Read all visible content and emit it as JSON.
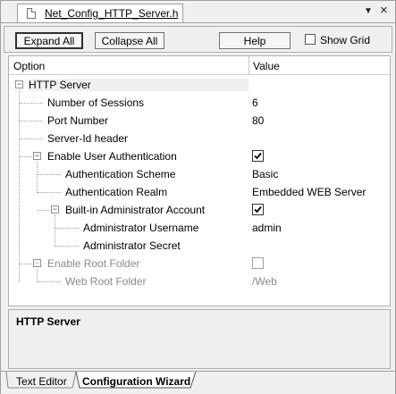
{
  "file_tab": {
    "name": "Net_Config_HTTP_Server.h"
  },
  "window_controls": {
    "dropdown": "▼",
    "close": "×"
  },
  "toolbar": {
    "expand_all": "Expand All",
    "collapse_all": "Collapse All",
    "help": "Help",
    "show_grid": "Show Grid"
  },
  "grid": {
    "col_option": "Option",
    "col_value": "Value",
    "rows": [
      {
        "label": "HTTP Server",
        "value": ""
      },
      {
        "label": "Number of Sessions",
        "value": "6"
      },
      {
        "label": "Port Number",
        "value": "80"
      },
      {
        "label": "Server-Id header",
        "value": ""
      },
      {
        "label": "Enable User Authentication",
        "value": "checked"
      },
      {
        "label": "Authentication Scheme",
        "value": "Basic"
      },
      {
        "label": "Authentication Realm",
        "value": "Embedded WEB Server"
      },
      {
        "label": "Built-in Administrator Account",
        "value": "checked"
      },
      {
        "label": "Administrator Username",
        "value": "admin"
      },
      {
        "label": "Administrator Secret",
        "value": ""
      },
      {
        "label": "Enable Root Folder",
        "value": "unchecked"
      },
      {
        "label": "Web Root Folder",
        "value": "/Web"
      }
    ]
  },
  "description": {
    "title": "HTTP Server"
  },
  "bottom_tabs": {
    "text_editor": "Text Editor",
    "config_wizard": "Configuration Wizard"
  }
}
